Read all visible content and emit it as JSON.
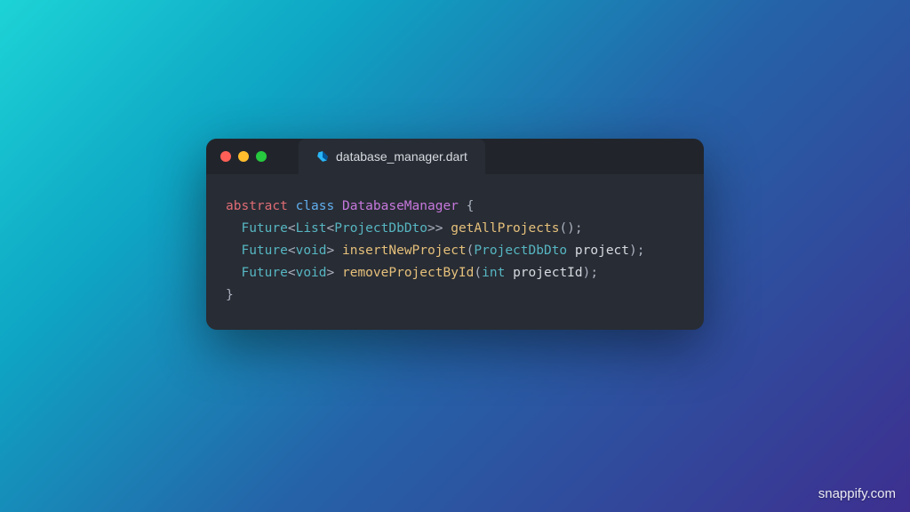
{
  "window": {
    "tab_filename": "database_manager.dart"
  },
  "code": {
    "kw_abstract": "abstract",
    "kw_class": "class",
    "type_name": "DatabaseManager",
    "open_brace": " {",
    "future": "Future",
    "list": "List",
    "dto": "ProjectDbDto",
    "void": "void",
    "int": "int",
    "m1": "getAllProjects",
    "m2": "insertNewProject",
    "m3": "removeProjectById",
    "p2": "project",
    "p3": "projectId",
    "close_brace": "}"
  },
  "watermark": "snappify.com"
}
